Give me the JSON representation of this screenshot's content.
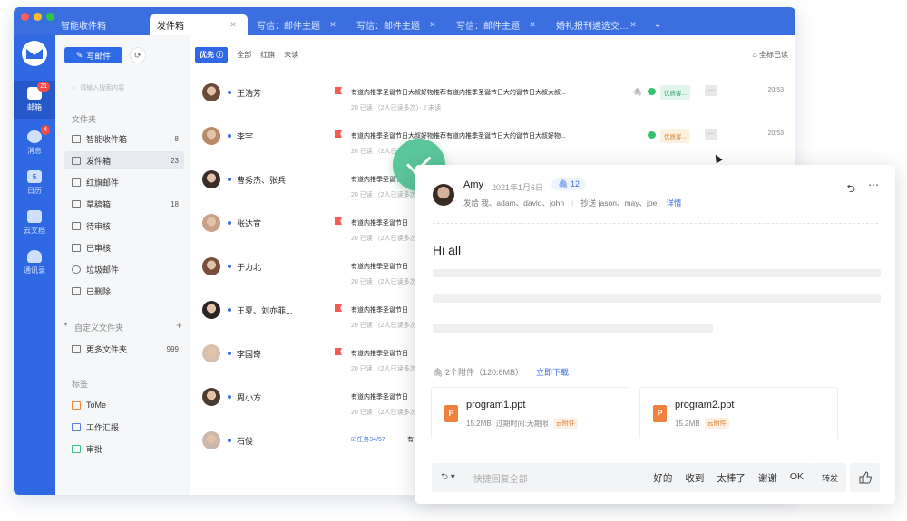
{
  "colors": {
    "brand": "#3b6fe0",
    "rail": "#2f68e3",
    "check": "#5bc59b",
    "flag": "#f45b54"
  },
  "tabs": [
    {
      "label": "智能收件箱",
      "active": false
    },
    {
      "label": "发件箱",
      "active": true
    },
    {
      "label": "写信：邮件主题",
      "active": false
    },
    {
      "label": "写信：邮件主题",
      "active": false
    },
    {
      "label": "写信：邮件主题",
      "active": false
    },
    {
      "label": "婚礼报刊遴选交…",
      "active": false
    }
  ],
  "rail": {
    "items": [
      {
        "label": "邮箱",
        "icon": "mail-icon",
        "badge": "21",
        "active": true
      },
      {
        "label": "消息",
        "icon": "chat-icon",
        "badge": "4",
        "active": false
      },
      {
        "label": "日历",
        "icon": "calendar-icon",
        "glyph": "5",
        "active": false
      },
      {
        "label": "云文档",
        "icon": "folder-icon",
        "active": false
      },
      {
        "label": "通讯录",
        "icon": "contacts-icon",
        "active": false
      }
    ]
  },
  "folders": {
    "compose": "写邮件",
    "search_placeholder": "请输入搜索内容",
    "section": "文件夹",
    "items": [
      {
        "label": "智能收件箱",
        "count": "8"
      },
      {
        "label": "发件箱",
        "count": "23",
        "active": true
      },
      {
        "label": "红旗邮件",
        "count": ""
      },
      {
        "label": "草稿箱",
        "count": "18"
      },
      {
        "label": "待审核",
        "count": ""
      },
      {
        "label": "已审核",
        "count": ""
      },
      {
        "label": "垃圾邮件",
        "count": ""
      },
      {
        "label": "已删除",
        "count": ""
      }
    ],
    "custom_section": "自定义文件夹",
    "custom_items": [
      {
        "label": "更多文件夹",
        "count": "999"
      }
    ],
    "tags_section": "标签",
    "tags": [
      {
        "label": "ToMe"
      },
      {
        "label": "工作汇报"
      },
      {
        "label": "审批"
      }
    ]
  },
  "list": {
    "filters": {
      "priority": "优先",
      "all": "全部",
      "flag": "红旗",
      "unread": "未读"
    },
    "mark_all": "全标已读",
    "rows": [
      {
        "name": "王浩芳",
        "flag": true,
        "subject": "有道内推季圣诞节日大叔好物推荐有道内推季圣诞节日大的诞节日大叔大叔...",
        "meta": "20 已读  （2人已读多次）· 2 未读",
        "tag": "优质客...",
        "tagColor": "green",
        "time": "20:53"
      },
      {
        "name": "李宇",
        "flag": true,
        "subject": "有道内推季圣诞节日大叔好物推荐有道内推季圣诞节日大的诞节日大叔好物...",
        "meta": "20 已读  （2人已读多次）· 2 未读",
        "tag": "优质客...",
        "tagColor": "orange",
        "time": "20:53"
      },
      {
        "name": "曹秀杰、张兵",
        "flag": false,
        "subject": "有道内推季圣诞节日",
        "meta": "20 已读  （2人已读多次）",
        "time": ""
      },
      {
        "name": "张达宣",
        "flag": true,
        "subject": "有道内推季圣诞节日",
        "meta": "20 已读  （2人已读多次）",
        "time": ""
      },
      {
        "name": "于力北",
        "flag": false,
        "subject": "有道内推季圣诞节日",
        "meta": "20 已读  （2人已读多次）",
        "time": ""
      },
      {
        "name": "王夏、刘亦菲...",
        "flag": true,
        "subject": "有道内推季圣诞节日",
        "meta": "20 已读  （2人已读多次）",
        "time": ""
      },
      {
        "name": "李国奇",
        "flag": true,
        "subject": "有道内推季圣诞节日",
        "meta": "20 已读  （2人已读多次）",
        "time": ""
      },
      {
        "name": "周小方",
        "flag": false,
        "subject": "有道内推季圣诞节日",
        "meta": "20 已读  （2人已读多次）",
        "time": ""
      },
      {
        "name": "石俊",
        "flag": false,
        "task": "任务34/57",
        "task2": "有",
        "meta": "",
        "time": ""
      }
    ]
  },
  "reader": {
    "sender": "Amy",
    "date": "2021年1月6日",
    "attach_count": "12",
    "to_label": "发给",
    "to": "我、adam、david、john",
    "cc_label": "抄送",
    "cc": "jason、may、joe",
    "detail": "详情",
    "greeting": "Hi all",
    "attach_summary": "2个附件（120.6MB）",
    "download": "立即下载",
    "files": [
      {
        "name": "program1.ppt",
        "size": "15.2MB",
        "expire": "过期时间:无期限",
        "badge": "云附件"
      },
      {
        "name": "program2.ppt",
        "size": "15.2MB",
        "expire": "",
        "badge": "云附件"
      }
    ],
    "reply_placeholder": "快捷回复全部",
    "quick_replies": [
      "好的",
      "收到",
      "太棒了",
      "谢谢",
      "OK"
    ],
    "forward": "转发"
  }
}
